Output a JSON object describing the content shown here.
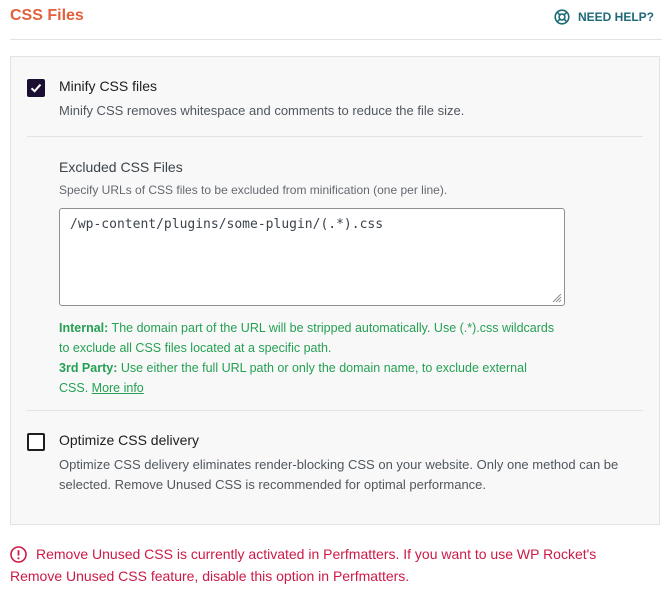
{
  "header": {
    "title": "CSS Files",
    "help_label": "NEED HELP?",
    "help_icon": "lifebuoy-icon"
  },
  "minify": {
    "label": "Minify CSS files",
    "checked": true,
    "description": "Minify CSS removes whitespace and comments to reduce the file size.",
    "excluded": {
      "title": "Excluded CSS Files",
      "description": "Specify URLs of CSS files to be excluded from minification (one per line).",
      "value": "/wp-content/plugins/some-plugin/(.*).css",
      "help_internal_label": "Internal:",
      "help_internal_text": " The domain part of the URL will be stripped automatically. Use (.*).css wildcards to exclude all CSS files located at a specific path.",
      "help_third_label": "3rd Party:",
      "help_third_text": " Use either the full URL path or only the domain name, to exclude external CSS. ",
      "more_info": "More info"
    }
  },
  "optimize": {
    "label": "Optimize CSS delivery",
    "checked": false,
    "description": "Optimize CSS delivery eliminates render-blocking CSS on your website. Only one method can be selected. Remove Unused CSS is recommended for optimal performance."
  },
  "warning": {
    "icon": "alert-circle-icon",
    "text": "Remove Unused CSS is currently activated in Perfmatters. If you want to use WP Rocket's Remove Unused CSS feature, disable this option in Perfmatters."
  },
  "colors": {
    "title": "#e2613c",
    "help": "#1e6a78",
    "checkbox_checked": "#1a0f33",
    "help_text": "#25a053",
    "warning": "#cc1a46"
  }
}
